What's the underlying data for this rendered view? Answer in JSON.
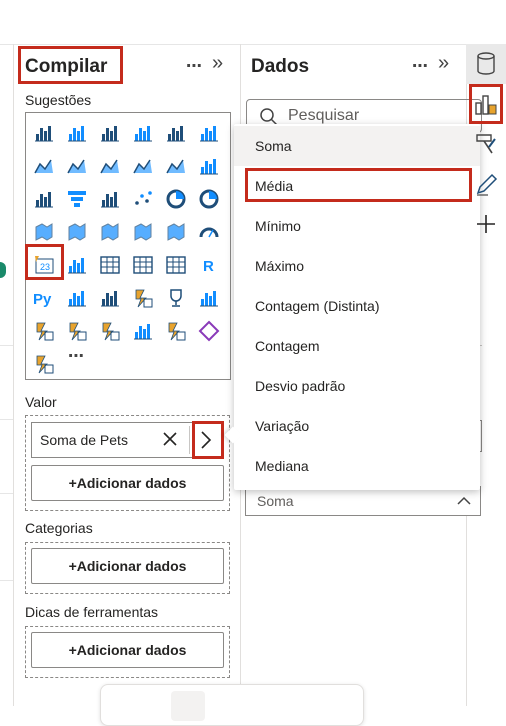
{
  "build_pane": {
    "title": "Compilar",
    "more_label": "⋯",
    "expand_label": "»",
    "suggestions_label": "Sugestões",
    "more_visuals_label": "⋯",
    "value_label": "Valor",
    "value_field": "Soma de Pets",
    "add_data_label": "+Adicionar dados",
    "categories_label": "Categorias",
    "tooltips_label": "Dicas de ferramentas"
  },
  "data_pane": {
    "title": "Dados",
    "more_label": "⋯",
    "expand_label": "»",
    "search_placeholder": "Pesquisar",
    "aggregation_selected": "Soma"
  },
  "aggregation_menu": {
    "items": [
      "Soma",
      "Média",
      "Mínimo",
      "Máximo",
      "Contagem (Distinta)",
      "Contagem",
      "Desvio padrão",
      "Variação",
      "Mediana"
    ]
  },
  "visual_icons": [
    "stacked-bar-icon",
    "stacked-column-icon",
    "clustered-bar-icon",
    "clustered-column-icon",
    "100-bar-icon",
    "100-column-icon",
    "line-chart-icon",
    "area-chart-icon",
    "stacked-area-icon",
    "ribbon-icon",
    "line-column-icon",
    "waterfall-icon",
    "combo-icon",
    "funnel-icon",
    "waterfall2-icon",
    "scatter-icon",
    "pie-icon",
    "donut-icon",
    "treemap-icon",
    "map-icon",
    "filled-map-icon",
    "shape-map-icon",
    "azure-map-icon",
    "gauge-icon",
    "card-icon",
    "kpi-icon",
    "slicer-icon",
    "table-icon",
    "matrix-icon",
    "r-visual-icon",
    "python-icon",
    "key-influencers-icon",
    "decomposition-tree-icon",
    "smart-narrative-icon",
    "trophy-icon",
    "paginated-icon",
    "power-apps-icon",
    "qa-icon",
    "narrative-icon",
    "image-icon",
    "powerbi-icon",
    "diamond-icon",
    "power-automate-icon"
  ],
  "colors": {
    "accent_red": "#c42b1c",
    "blue": "#118dff",
    "dark_blue": "#1f4e79",
    "border": "#8a8886"
  }
}
